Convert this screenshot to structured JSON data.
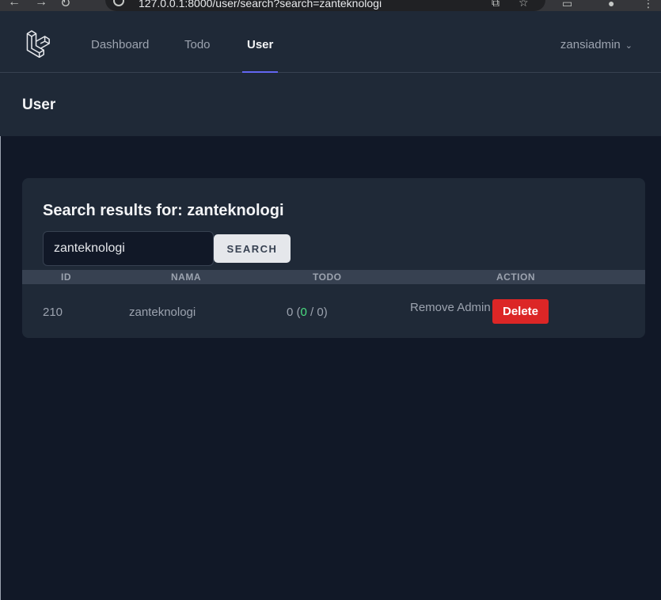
{
  "browser": {
    "url": "127.0.0.1:8000/user/search?search=zanteknologi"
  },
  "nav": {
    "links": [
      "Dashboard",
      "Todo",
      "User"
    ],
    "active": "User",
    "user_name": "zansiadmin"
  },
  "page": {
    "title": "User"
  },
  "search": {
    "results_title": "Search results for: zanteknologi",
    "value": "zanteknologi",
    "button_label": "SEARCH"
  },
  "table": {
    "headers": [
      "ID",
      "NAMA",
      "TODO",
      "ACTION"
    ],
    "rows": [
      {
        "id": "210",
        "nama": "zanteknologi",
        "todo_total": "0",
        "todo_done": "0",
        "todo_all": "0",
        "action_remove": "Remove Admin",
        "action_delete": "Delete"
      }
    ]
  },
  "colors": {
    "accent": "#6366f1",
    "delete": "#dc2626",
    "done": "#4ade80"
  }
}
